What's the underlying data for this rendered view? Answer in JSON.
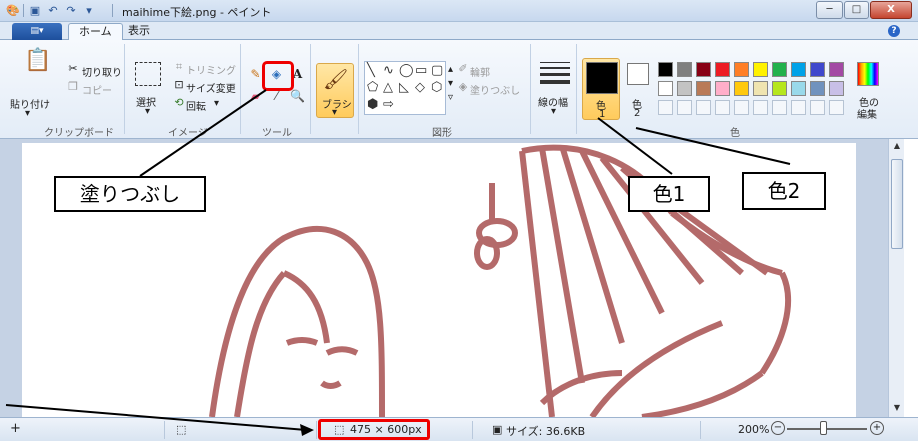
{
  "window": {
    "title": "maihime下絵.png - ペイント",
    "minimize": "─",
    "maximize": "□",
    "close": "X"
  },
  "tabs": {
    "file": "▤▾",
    "home": "ホーム",
    "view": "表示"
  },
  "clipboard": {
    "paste": "貼り付け",
    "cut": "切り取り",
    "copy": "コピー",
    "label": "クリップボード"
  },
  "image": {
    "select": "選択",
    "crop": "トリミング",
    "resize": "サイズ変更",
    "rotate": "回転",
    "label": "イメージ"
  },
  "tools": {
    "label": "ツール"
  },
  "brush": {
    "label": "ブラシ"
  },
  "shapes": {
    "outline": "輪郭",
    "fill": "塗りつぶし",
    "label": "図形"
  },
  "size": {
    "label": "線の幅"
  },
  "colors": {
    "color1": "色",
    "color1_num": "1",
    "color2": "色",
    "color2_num": "2",
    "edit": "色の",
    "edit2": "編集",
    "label": "色",
    "color1_value": "#000000",
    "color2_value": "#ffffff",
    "palette_row1": [
      "#000000",
      "#7f7f7f",
      "#880015",
      "#ed1c24",
      "#ff7f27",
      "#fff200",
      "#22b14c",
      "#00a2e8",
      "#3f48cc",
      "#a349a4"
    ],
    "palette_row2": [
      "#ffffff",
      "#c3c3c3",
      "#b97a57",
      "#ffaec9",
      "#ffc90e",
      "#efe4b0",
      "#b5e61d",
      "#99d9ea",
      "#7092be",
      "#c8bfe7"
    ]
  },
  "callouts": {
    "fill_tool": "塗りつぶし",
    "color1": "色1",
    "color2": "色2"
  },
  "status": {
    "dimensions": "475 × 600px",
    "filesize": "サイズ: 36.6KB",
    "zoom": "200%"
  },
  "theme": {
    "image_color": "#b46a6a",
    "highlight": "#ee0000"
  }
}
